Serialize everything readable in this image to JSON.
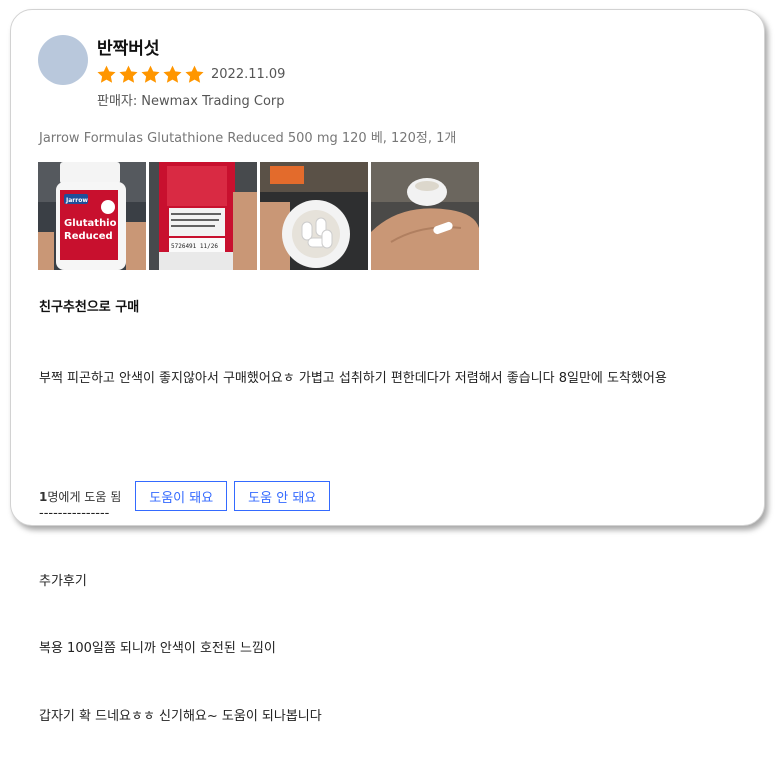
{
  "review": {
    "author": "반짝버섯",
    "rating": 5,
    "rating_max": 5,
    "date": "2022.11.09",
    "seller_label": "판매자:",
    "seller_name": "Newmax Trading Corp",
    "product": "Jarrow Formulas Glutathione Reduced 500 mg 120 베, 120정, 1개",
    "photos": [
      {
        "name": "photo-bottle-front",
        "label": "Glutathione Reduced"
      },
      {
        "name": "photo-bottle-back",
        "label": ""
      },
      {
        "name": "photo-open-bottle",
        "label": ""
      },
      {
        "name": "photo-capsule-in-hand",
        "label": ""
      }
    ],
    "headline": "친구추천으로 구매",
    "body_lines": [
      "부쩍 피곤하고 안색이 좋지않아서 구매했어요ㅎ 가볍고 섭취하기 편한데다가 저렴해서 좋습니다 8일만에 도착했어용",
      "",
      "---------------",
      "추가후기",
      "복용 100일쯤 되니까 안색이 호전된 느낌이",
      "갑자기 확 드네요ㅎㅎ 신기해요~ 도움이 되나봅니다"
    ],
    "helpful_count": "1",
    "helpful_suffix": "명에게 도움 됨",
    "btn_helpful": "도움이 돼요",
    "btn_not_helpful": "도움 안 돼요"
  },
  "colors": {
    "star": "#ff9600",
    "accent": "#346aff",
    "avatar": "#b9c8dc"
  },
  "icons": {
    "star": "star-icon"
  }
}
